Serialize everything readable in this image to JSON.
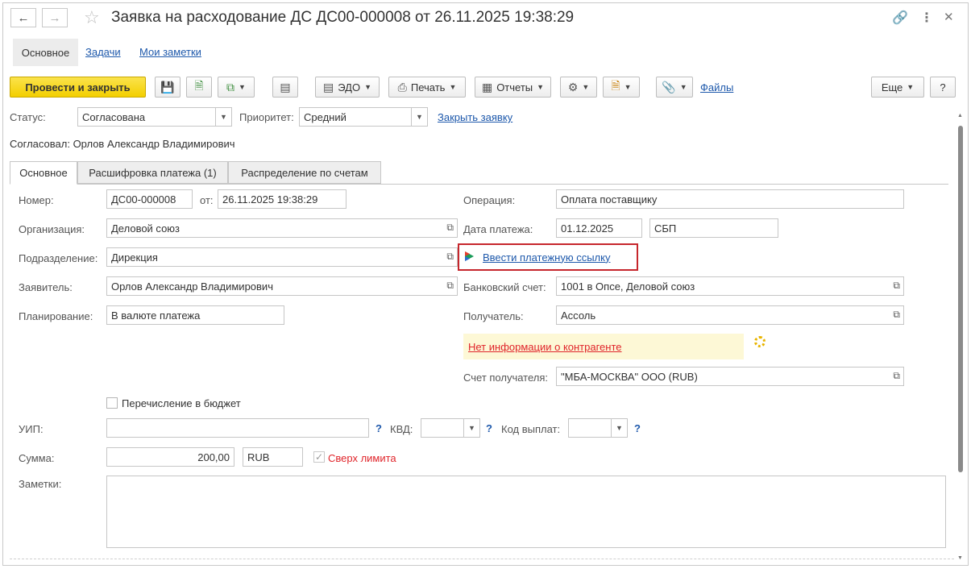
{
  "window": {
    "title": "Заявка на расходование ДС ДС00-000008 от 26.11.2025 19:38:29",
    "back_icon": "arrow-left-icon",
    "forward_icon": "arrow-right-icon",
    "favorite_icon": "star-icon",
    "link_icon": "link-icon",
    "more_icon": "more-vertical-icon",
    "close_icon": "close-icon"
  },
  "page_tabs": [
    "Основное",
    "Задачи",
    "Мои заметки"
  ],
  "toolbar": {
    "post_close": "Провести и закрыть",
    "edo": "ЭДО",
    "print": "Печать",
    "reports": "Отчеты",
    "files": "Файлы",
    "more": "Еще",
    "help": "?"
  },
  "status": {
    "status_label": "Статус:",
    "status_value": "Согласована",
    "priority_label": "Приоритет:",
    "priority_value": "Средний",
    "close_link": "Закрыть заявку",
    "approved_by": "Согласовал: Орлов Александр Владимирович"
  },
  "content_tabs": [
    "Основное",
    "Расшифровка платежа (1)",
    "Распределение по счетам"
  ],
  "form": {
    "number_label": "Номер:",
    "number": "ДС00-000008",
    "from_label": "от:",
    "date": "26.11.2025 19:38:29",
    "org_label": "Организация:",
    "org": "Деловой союз",
    "dept_label": "Подразделение:",
    "dept": "Дирекция",
    "applicant_label": "Заявитель:",
    "applicant": "Орлов Александр Владимирович",
    "planning_label": "Планирование:",
    "planning": "В валюте платежа",
    "operation_label": "Операция:",
    "operation": "Оплата поставщику",
    "paydate_label": "Дата платежа:",
    "paydate": "01.12.2025",
    "pay_method": "СБП",
    "pay_link": "Ввести платежную ссылку",
    "bank_label": "Банковский счет:",
    "bank": "1001 в Опсе, Деловой союз",
    "recipient_label": "Получатель:",
    "recipient": "Ассоль",
    "no_info": "Нет информации о контрагенте",
    "recipient_account_label": "Счет получателя:",
    "recipient_account": "\"МБА-МОСКВА\" ООО (RUB)",
    "budget_label": "Перечисление в бюджет",
    "uip_label": "УИП:",
    "kvd_label": "КВД:",
    "payout_code_label": "Код выплат:",
    "amount_label": "Сумма:",
    "amount": "200,00",
    "currency": "RUB",
    "over_limit": "Сверх лимита",
    "notes_label": "Заметки:"
  },
  "colors": {
    "accent_link": "#1d58ab",
    "primary_button": "#f3cf00",
    "warning_text": "#e0242a",
    "warning_bg": "#fdf8d6",
    "highlight_border": "#c6262c"
  }
}
